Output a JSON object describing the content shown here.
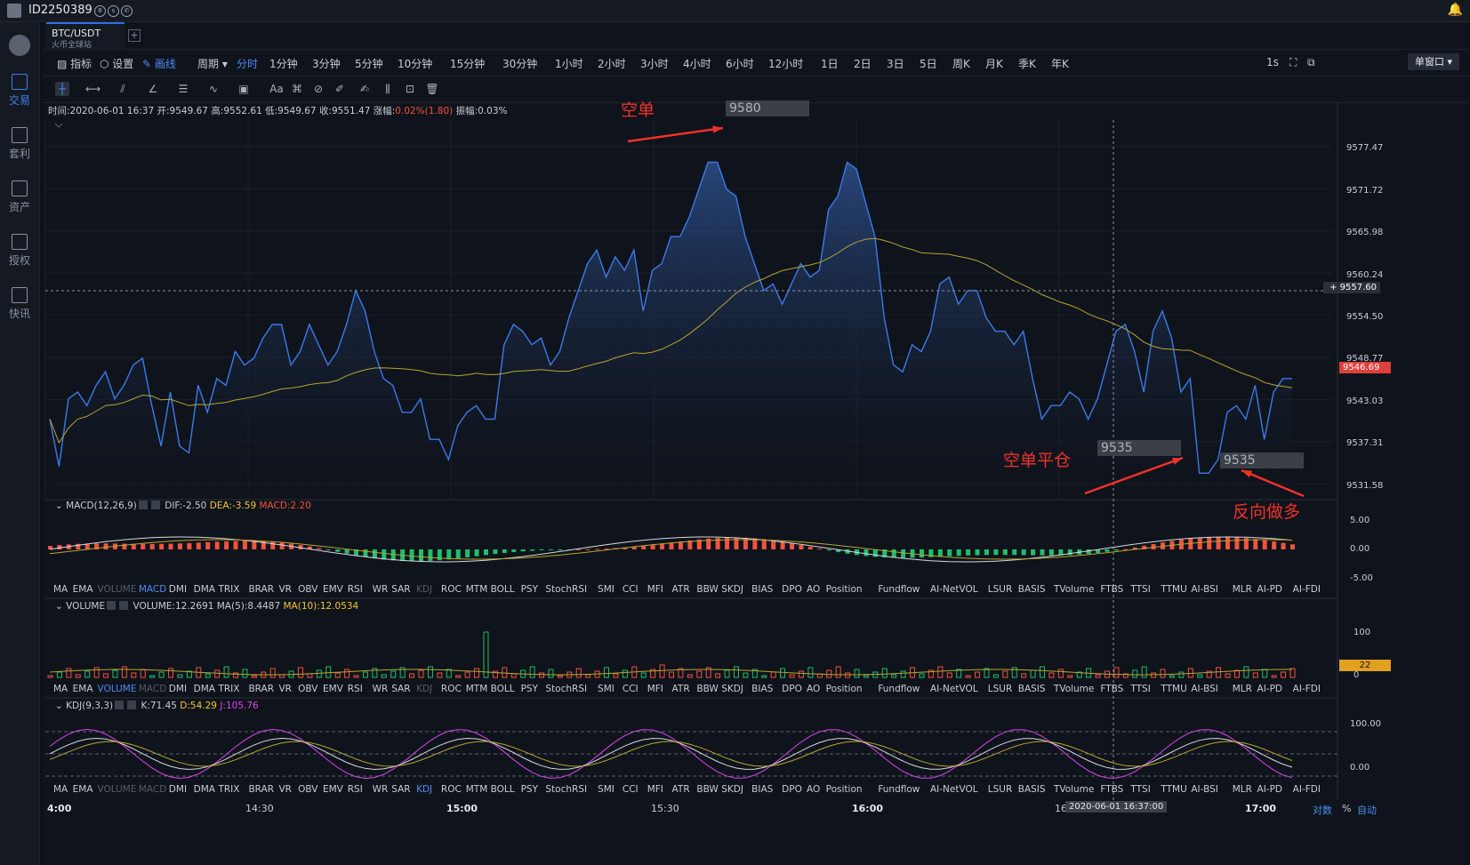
{
  "top": {
    "user_id": "ID2250389",
    "icons": [
      "badge-icon",
      "shield-icon",
      "phone-icon"
    ],
    "bell": "bell-icon"
  },
  "sidebar": {
    "items": [
      {
        "label": "交易",
        "icon": "trade-icon",
        "active": true
      },
      {
        "label": "套利",
        "icon": "arbitrage-icon",
        "active": false
      },
      {
        "label": "资产",
        "icon": "wallet-icon",
        "active": false
      },
      {
        "label": "授权",
        "icon": "key-icon",
        "active": false
      },
      {
        "label": "快讯",
        "icon": "news-icon",
        "active": false
      }
    ]
  },
  "pair_tab": {
    "symbol": "BTC/USDT",
    "exchange": "火币全球站",
    "add": "+"
  },
  "toolbar": {
    "indicator": "指标",
    "settings": "设置",
    "draw": "画线",
    "period": "周期",
    "periods": [
      "分时",
      "1分钟",
      "3分钟",
      "5分钟",
      "10分钟",
      "15分钟",
      "30分钟",
      "1小时",
      "2小时",
      "3小时",
      "4小时",
      "6小时",
      "12小时",
      "1日",
      "2日",
      "3日",
      "5日",
      "周K",
      "月K",
      "季K",
      "年K"
    ],
    "active_period": "分时",
    "refresh": "1s",
    "window": "单窗口"
  },
  "draw_tools": [
    "crosshair-icon",
    "horizontal-line-icon",
    "trend-line-icon",
    "angle-icon",
    "channel-icon",
    "wave-icon",
    "rect-icon",
    "text-icon",
    "pattern-icon",
    "measure-icon",
    "ruler-icon",
    "brush-icon",
    "fib-icon",
    "lock-icon",
    "trash-icon"
  ],
  "draw_text_tool": "Aa",
  "info": {
    "time": "时间:2020-06-01 16:37",
    "open": "开:9549.67",
    "high": "高:9552.61",
    "low": "低:9549.67",
    "close": "收:9551.47",
    "change_label": "涨幅:",
    "change": "0.02%(1.80)",
    "amp": "振幅:0.03%"
  },
  "price_axis": [
    "9577.47",
    "9571.72",
    "9565.98",
    "9560.24",
    "9554.50",
    "9548.77",
    "9543.03",
    "9537.31",
    "9531.58"
  ],
  "crosshair_price": "9557.60",
  "last_price": "9546.69",
  "annotations": {
    "short": "空单",
    "close_short": "空单平仓",
    "reverse_long": "反向做多",
    "price_high": "9580",
    "price_low1": "9535",
    "price_low2": "9535"
  },
  "macd": {
    "name": "MACD(12,26,9)",
    "dif": "DIF:-2.50",
    "dea": "DEA:-3.59",
    "macd": "MACD:2.20",
    "axis": [
      "5.00",
      "0.00",
      "-5.00"
    ]
  },
  "volume": {
    "name": "VOLUME",
    "vol": "VOLUME:12.2691",
    "ma5": "MA(5):8.4487",
    "ma10": "MA(10):12.0534",
    "axis": [
      "100",
      "0"
    ],
    "tag": "22"
  },
  "kdj": {
    "name": "KDJ(9,3,3)",
    "k": "K:71.45",
    "d": "D:54.29",
    "j": "J:105.76",
    "axis": [
      "100.00",
      "0.00"
    ]
  },
  "indicator_tabs": [
    "MA",
    "EMA",
    "VOLUME",
    "MACD",
    "DMI",
    "DMA",
    "TRIX",
    "BRAR",
    "VR",
    "OBV",
    "EMV",
    "RSI",
    "WR",
    "SAR",
    "KDJ",
    "ROC",
    "MTM",
    "BOLL",
    "PSY",
    "StochRSI",
    "SMI",
    "CCI",
    "MFI",
    "ATR",
    "BBW",
    "SKDJ",
    "BIAS",
    "DPO",
    "AO",
    "Position",
    "Fundflow",
    "AI-NetVOL",
    "LSUR",
    "BASIS",
    "TVolume",
    "FTBS",
    "TTSI",
    "TTMU",
    "AI-BSI",
    "MLR",
    "AI-PD",
    "AI-FDI"
  ],
  "time_axis": [
    {
      "label": "4:00",
      "bold": true
    },
    {
      "label": "14:30",
      "bold": false
    },
    {
      "label": "15:00",
      "bold": true
    },
    {
      "label": "15:30",
      "bold": false
    },
    {
      "label": "16:00",
      "bold": true
    },
    {
      "label": "16",
      "bold": false
    },
    {
      "label": "17:00",
      "bold": true
    }
  ],
  "crosshair_time": "2020-06-01 16:37:00",
  "bottom_right": {
    "log": "对数",
    "pct": "%",
    "auto": "自动"
  },
  "colors": {
    "bg": "#0f131b",
    "line": "#3b7ae8",
    "ma": "#b8a531",
    "up": "#f0533f",
    "down": "#1fbf6a",
    "accent": "#4c8df6",
    "annot": "#f0322a"
  },
  "chart_data": {
    "type": "line",
    "title": "",
    "price_series": [
      9541,
      9534,
      9544,
      9545,
      9543,
      9546,
      9548,
      9544,
      9546,
      9549,
      9550,
      9543,
      9537,
      9545,
      9537,
      9536,
      9546,
      9542,
      9547,
      9546,
      9551,
      9549,
      9550,
      9553,
      9555,
      9555,
      9549,
      9551,
      9555,
      9552,
      9549,
      9551,
      9555,
      9560,
      9557,
      9551,
      9547,
      9546,
      9542,
      9542,
      9544,
      9538,
      9538,
      9535,
      9540,
      9542,
      9543,
      9541,
      9541,
      9552,
      9555,
      9554,
      9552,
      9553,
      9549,
      9551,
      9556,
      9560,
      9564,
      9566,
      9562,
      9565,
      9563,
      9566,
      9557,
      9563,
      9564,
      9568,
      9568,
      9571,
      9575,
      9579,
      9579,
      9575,
      9574,
      9568,
      9564,
      9560,
      9561,
      9558,
      9561,
      9564,
      9562,
      9563,
      9572,
      9574,
      9579,
      9578,
      9573,
      9568,
      9556,
      9549,
      9548,
      9552,
      9551,
      9554,
      9561,
      9562,
      9558,
      9560,
      9560,
      9556,
      9554,
      9554,
      9552,
      9554,
      9547,
      9541,
      9543,
      9543,
      9545,
      9544,
      9541,
      9544,
      9549,
      9554,
      9555,
      9551,
      9545,
      9554,
      9557,
      9553,
      9545,
      9547,
      9533,
      9533,
      9535,
      9542,
      9543,
      9541,
      9546,
      9538,
      9545,
      9547,
      9547
    ]
  }
}
